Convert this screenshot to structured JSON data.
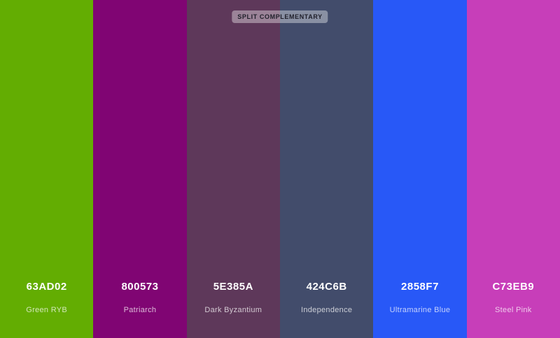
{
  "palette": {
    "scheme_label": "SPLIT COMPLEMENTARY",
    "colors": [
      {
        "hex": "63AD02",
        "name": "Green RYB",
        "color": "#63AD02"
      },
      {
        "hex": "800573",
        "name": "Patriarch",
        "color": "#800573"
      },
      {
        "hex": "5E385A",
        "name": "Dark Byzantium",
        "color": "#5E385A"
      },
      {
        "hex": "424C6B",
        "name": "Independence",
        "color": "#424C6B"
      },
      {
        "hex": "2858F7",
        "name": "Ultramarine Blue",
        "color": "#2858F7"
      },
      {
        "hex": "C73EB9",
        "name": "Steel Pink",
        "color": "#C73EB9"
      }
    ]
  }
}
